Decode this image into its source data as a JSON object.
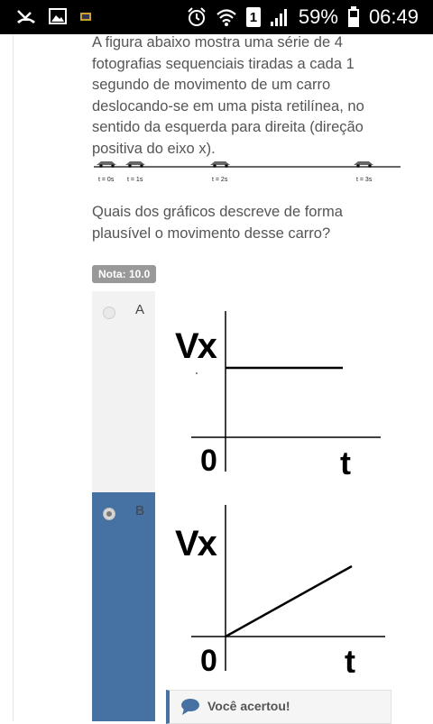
{
  "status_bar": {
    "battery_percent": "59%",
    "time": "06:49",
    "sim_slot": "1"
  },
  "question": {
    "intro": "A figura abaixo mostra uma série de 4 fotografias sequenciais tiradas a cada 1 segundo de movimento de um carro deslocando-se em uma pista retilínea, no sentido da esquerda para direita (direção positiva do eixo x).",
    "track_labels": [
      "t = 0s",
      "t = 1s",
      "t = 2s",
      "t = 3s"
    ],
    "prompt": "Quais dos gráficos descreve de forma plausível o movimento desse carro?",
    "grade": "Nota: 10.0"
  },
  "options": [
    {
      "letter": "A",
      "selected": false,
      "graph": {
        "y_label": "Vx",
        "x_label": "t",
        "origin": "0",
        "shape": "constant"
      }
    },
    {
      "letter": "B",
      "selected": true,
      "graph": {
        "y_label": "Vx",
        "x_label": "t",
        "origin": "0",
        "shape": "linear-increasing"
      }
    }
  ],
  "feedback": {
    "text": "Você acertou!",
    "icon": "speech-bubble-icon"
  },
  "colors": {
    "selected_bar": "#4571a3",
    "unselected_bar": "#f2f2f2",
    "grade_badge": "#999999"
  }
}
